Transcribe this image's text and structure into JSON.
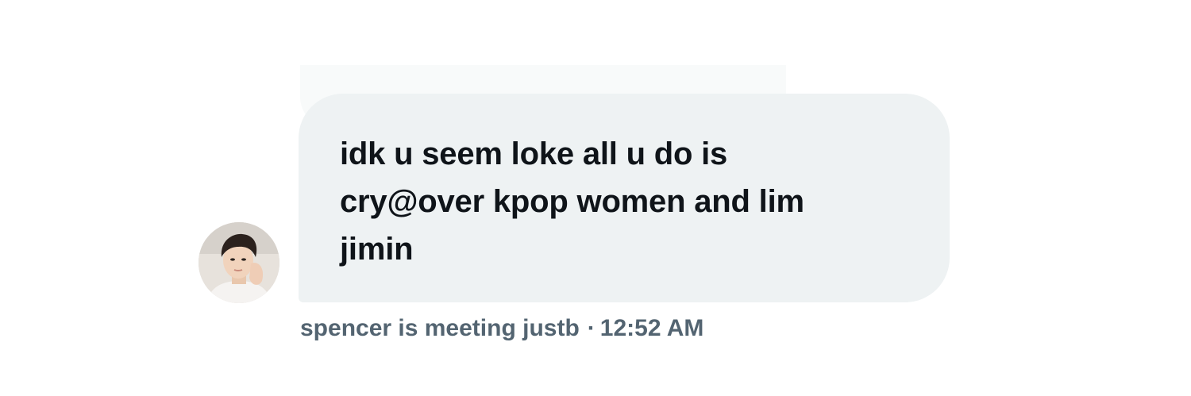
{
  "message": {
    "text": "idk u seem loke all u do is\ncry@over kpop women and lim\njimin",
    "sender": "spencer is meeting justb",
    "separator": "·",
    "time": "12:52 AM"
  },
  "avatar": {
    "icon": "avatar-photo"
  },
  "colors": {
    "bubble_bg": "#eef2f3",
    "text": "#0f1419",
    "meta": "#536471"
  }
}
